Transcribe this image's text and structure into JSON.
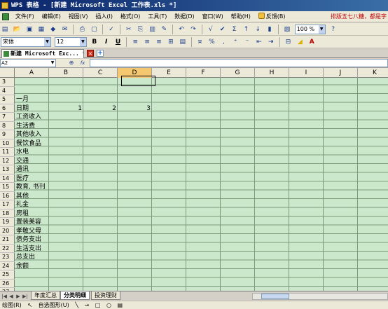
{
  "window": {
    "title": "WPS 表格 - [新建 Microsoft Excel 工作表.xls *]"
  },
  "menu": {
    "items": [
      "文件(F)",
      "编辑(E)",
      "视图(V)",
      "插入(I)",
      "格式(O)",
      "工具(T)",
      "数据(D)",
      "窗口(W)",
      "帮助(H)"
    ],
    "feedback": "反馈(B)",
    "slogan": "排版五七八糖，都是字"
  },
  "toolbar": {
    "zoom": "100 %"
  },
  "format": {
    "font_name": "宋体",
    "font_size": "12",
    "bold": "B",
    "italic": "I",
    "underline": "U"
  },
  "document_tab": {
    "title": "新建 Microsoft Exc... *"
  },
  "formula_bar": {
    "cell_ref": "A2",
    "fx": "fx"
  },
  "sheet": {
    "columns": [
      "A",
      "B",
      "C",
      "D",
      "E",
      "F",
      "G",
      "H",
      "I",
      "J",
      "K"
    ],
    "selected_column": "D",
    "rows": [
      "3",
      "4",
      "5",
      "6",
      "7",
      "8",
      "9",
      "10",
      "11",
      "12",
      "13",
      "14",
      "15",
      "16",
      "17",
      "18",
      "19",
      "20",
      "21",
      "22",
      "23",
      "24",
      "25",
      "26",
      "27"
    ],
    "cells_a": {
      "5": "一月",
      "6": "日期",
      "7": "工资收入",
      "8": "生活费",
      "9": "其他收入",
      "10": "餐饮食品",
      "11": "水电",
      "12": "交通",
      "13": "通讯",
      "14": "医疗",
      "15": "教育, 书刊",
      "16": "其他",
      "17": "礼金",
      "18": "房租",
      "19": "置装美容",
      "20": "孝敬父母",
      "21": "债务支出",
      "22": "生活支出",
      "23": "总支出",
      "24": "余额"
    },
    "row6": {
      "b": "1",
      "c": "2",
      "d": "3"
    }
  },
  "sheet_tabs": [
    "年度汇总",
    "分类明细",
    "投资理财"
  ],
  "active_sheet_tab": "分类明细",
  "drawbar": {
    "draw": "绘图(R)",
    "autoshape": "自选图形(U)"
  }
}
